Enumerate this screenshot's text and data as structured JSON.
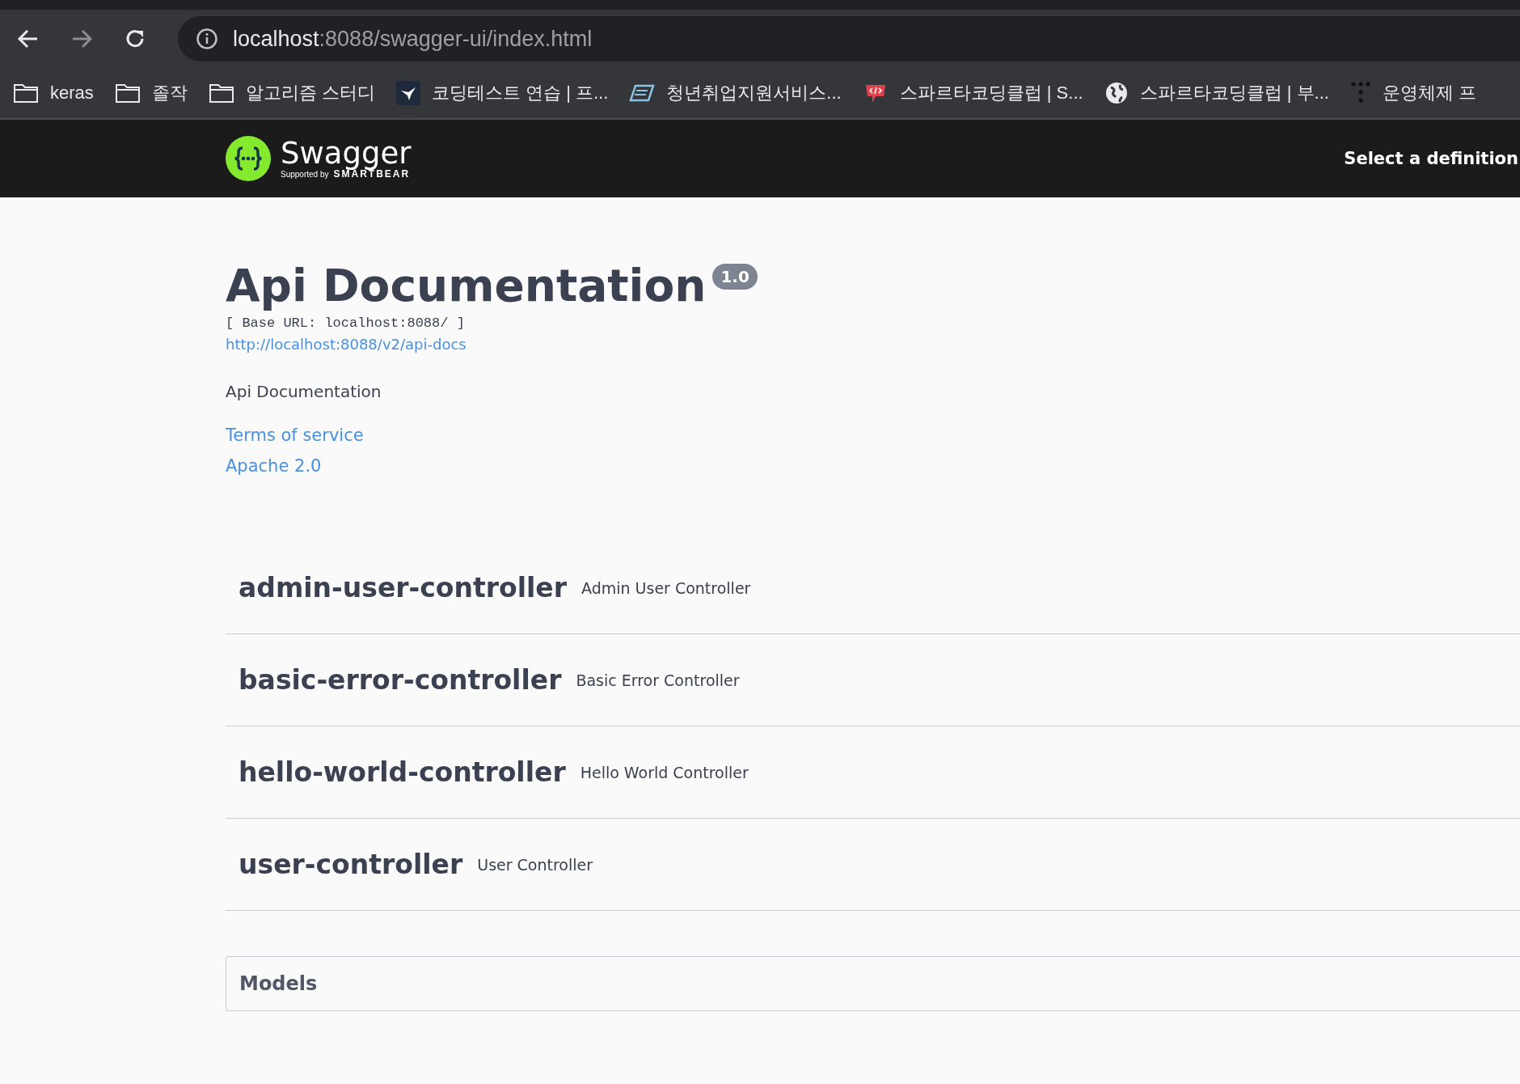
{
  "browser": {
    "address_host": "localhost",
    "address_path": ":8088/swagger-ui/index.html",
    "bookmarks": [
      {
        "label": "keras",
        "kind": "folder"
      },
      {
        "label": "졸작",
        "kind": "folder"
      },
      {
        "label": "알고리즘 스터디",
        "kind": "folder"
      },
      {
        "label": "코딩테스트 연습 | 프...",
        "kind": "bird"
      },
      {
        "label": "청년취업지원서비스...",
        "kind": "book"
      },
      {
        "label": "스파르타코딩클럽 | S...",
        "kind": "code"
      },
      {
        "label": "스파르타코딩클럽 | 부...",
        "kind": "globe"
      },
      {
        "label": "운영체제 프",
        "kind": "dots"
      }
    ]
  },
  "topbar": {
    "logo_text": "Swagger",
    "logo_sub": "Supported by",
    "logo_brand": "SMARTBEAR",
    "definition_label": "Select a definition"
  },
  "info": {
    "title": "Api Documentation",
    "version": "1.0",
    "base_url": "[ Base URL: localhost:8088/ ]",
    "docs_link": "http://localhost:8088/v2/api-docs",
    "description": "Api Documentation",
    "links": [
      "Terms of service",
      "Apache 2.0"
    ]
  },
  "tags": [
    {
      "name": "admin-user-controller",
      "description": "Admin User Controller"
    },
    {
      "name": "basic-error-controller",
      "description": "Basic Error Controller"
    },
    {
      "name": "hello-world-controller",
      "description": "Hello World Controller"
    },
    {
      "name": "user-controller",
      "description": "User Controller"
    }
  ],
  "models": {
    "title": "Models"
  }
}
